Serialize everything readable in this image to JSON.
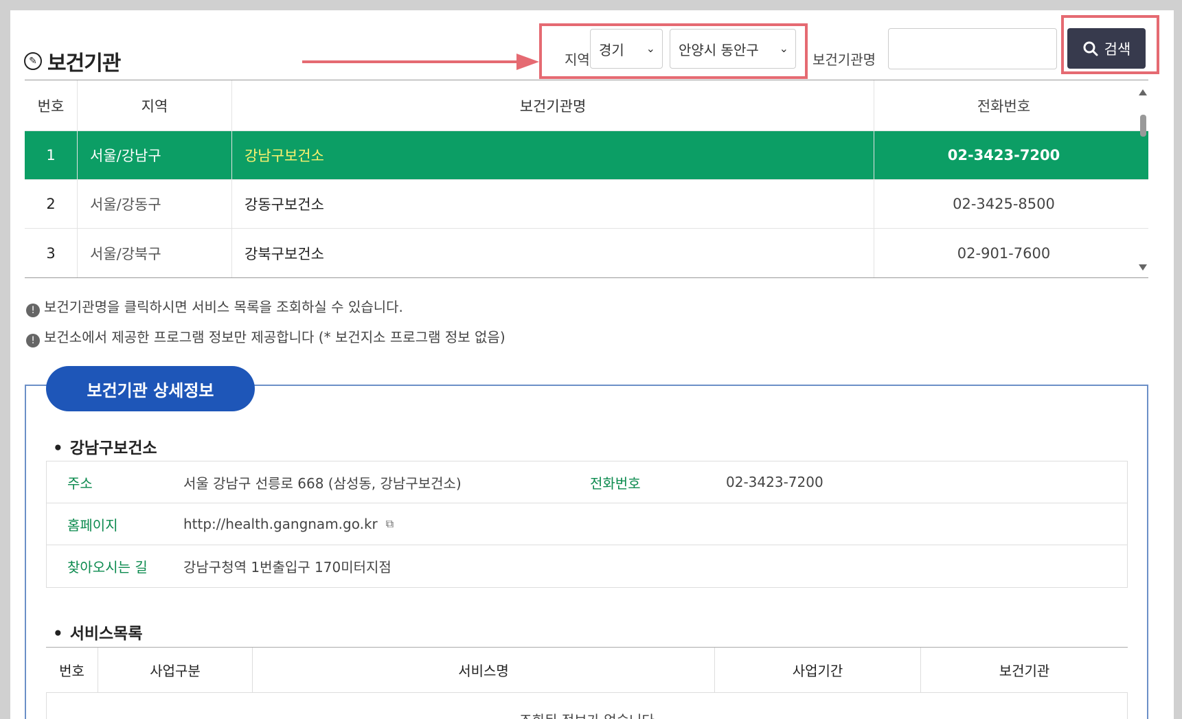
{
  "header": {
    "title": "보건기관",
    "region_label": "지역",
    "province_select": "경기",
    "city_select": "안양시 동안구",
    "name_label": "보건기관명",
    "name_value": "",
    "search_button": "검색"
  },
  "table": {
    "columns": [
      "번호",
      "지역",
      "보건기관명",
      "전화번호"
    ],
    "rows": [
      {
        "no": "1",
        "region": "서울/강남구",
        "name": "강남구보건소",
        "phone": "02-3423-7200"
      },
      {
        "no": "2",
        "region": "서울/강동구",
        "name": "강동구보건소",
        "phone": "02-3425-8500"
      },
      {
        "no": "3",
        "region": "서울/강북구",
        "name": "강북구보건소",
        "phone": "02-901-7600"
      }
    ]
  },
  "notes": [
    "보건기관명을 클릭하시면 서비스 목록을 조회하실 수 있습니다.",
    "보건소에서 제공한 프로그램 정보만 제공합니다 (* 보건지소 프로그램 정보 없음)"
  ],
  "detail": {
    "pill": "보건기관 상세정보",
    "facility_name": "강남구보건소",
    "address_label": "주소",
    "address": "서울 강남구 선릉로 668 (삼성동, 강남구보건소)",
    "phone_label": "전화번호",
    "phone": "02-3423-7200",
    "homepage_label": "홈페이지",
    "homepage": "http://health.gangnam.go.kr",
    "directions_label": "찾아오시는 길",
    "directions": "강남구청역 1번출입구 170미터지점",
    "services_title": "서비스목록",
    "service_columns": [
      "번호",
      "사업구분",
      "서비스명",
      "사업기간",
      "보건기관"
    ],
    "empty_message": "조회된 정보가 없습니다"
  },
  "colors": {
    "selected_row": "#0c9e65",
    "highlight_box": "#e56a72",
    "search_button": "#373a4d",
    "pill": "#1e56b8",
    "label_green": "#0b8a4e"
  }
}
